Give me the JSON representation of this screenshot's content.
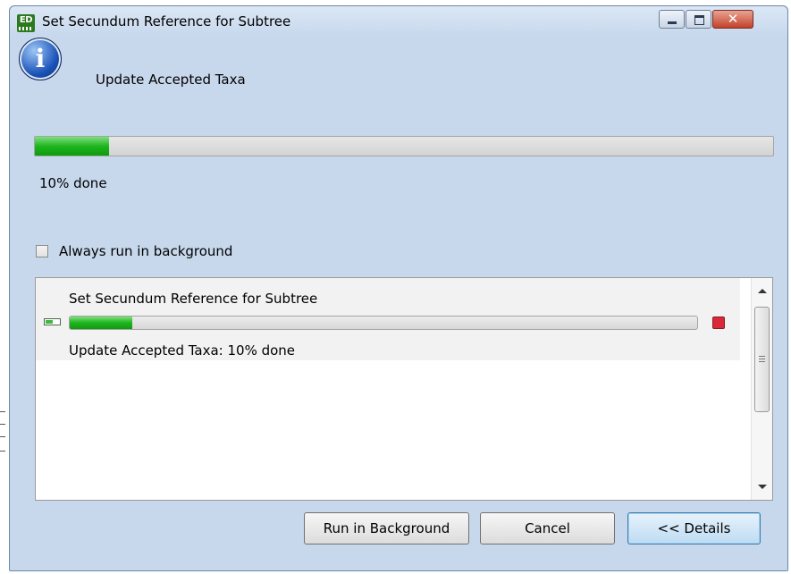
{
  "window": {
    "title": "Set Secundum Reference for Subtree",
    "app_icon_text": "ED"
  },
  "task": {
    "title": "Update Accepted Taxa",
    "progress": 0.1,
    "progress_label": "10% done"
  },
  "options": {
    "always_background_label": "Always run in background",
    "always_background_checked": false
  },
  "details": {
    "job_name": "Set Secundum Reference for Subtree",
    "job_progress": 0.1,
    "job_status": "Update Accepted Taxa:  10% done"
  },
  "buttons": {
    "run_in_background": "Run in Background",
    "cancel": "Cancel",
    "details": "<< Details"
  },
  "colors": {
    "progress_fill": "#1fb51f",
    "stop_button": "#d9283a",
    "close_button": "#c4412a"
  }
}
